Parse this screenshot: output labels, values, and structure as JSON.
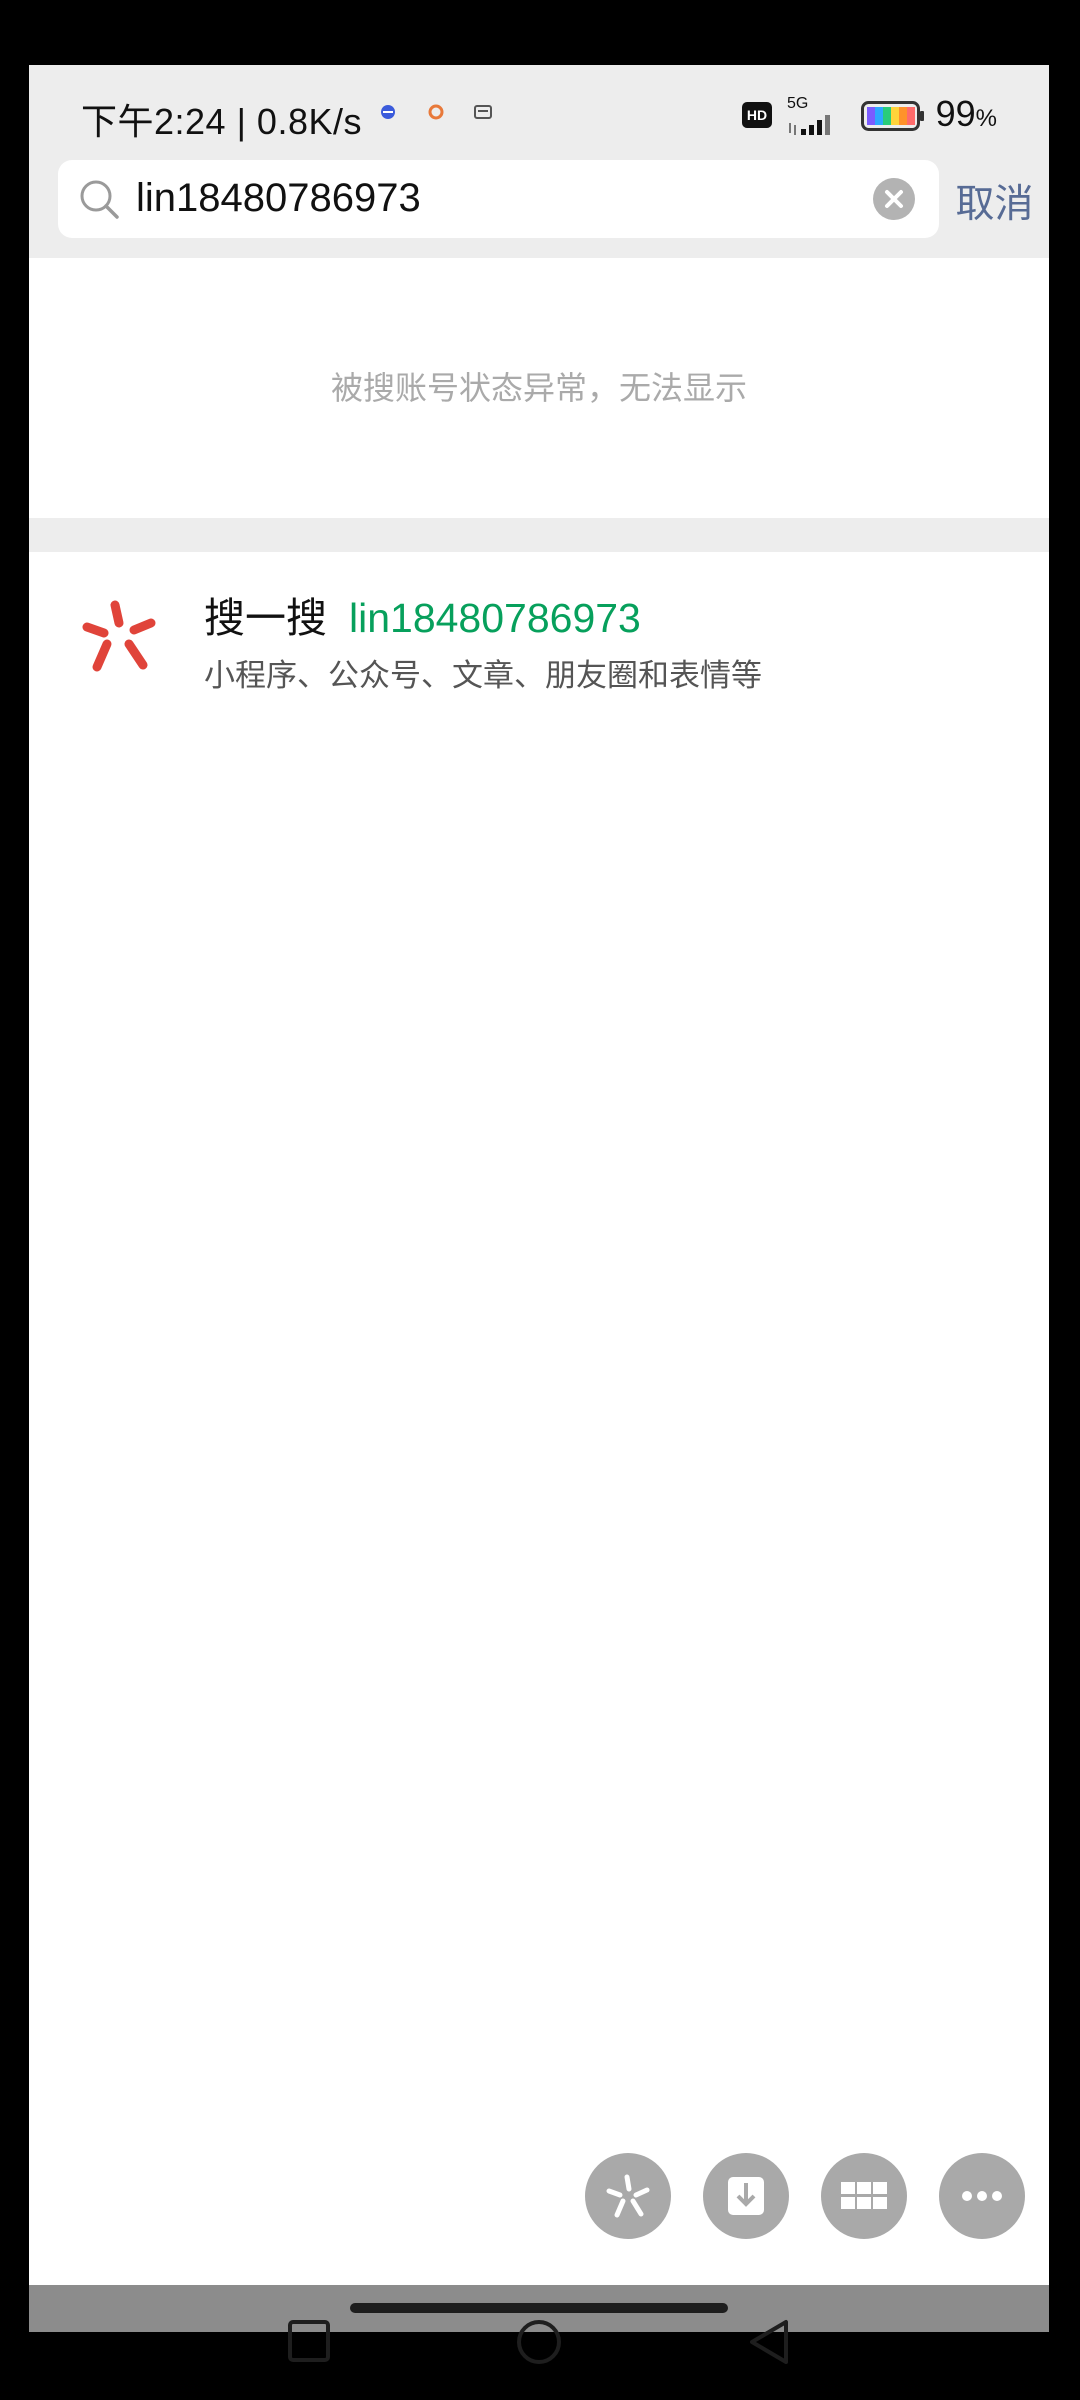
{
  "status_bar": {
    "time_and_speed": "下午2:24 | 0.8K/s",
    "network_hd": "HD",
    "network_type": "5G",
    "battery_percent": "99",
    "battery_unit": "%"
  },
  "search": {
    "query": "lin18480786973",
    "cancel_label": "取消",
    "icons": {
      "search": "search-icon",
      "clear": "clear-icon"
    }
  },
  "notice": {
    "message": "被搜账号状态异常，无法显示"
  },
  "result": {
    "title": "搜一搜",
    "keyword": "lin18480786973",
    "subtitle": "小程序、公众号、文章、朋友圈和表情等",
    "icon": "sousou-logo-icon"
  },
  "floating_buttons": [
    {
      "name": "sousou-float-icon"
    },
    {
      "name": "download-icon"
    },
    {
      "name": "grid-icon"
    },
    {
      "name": "more-icon"
    }
  ],
  "colors": {
    "keyword_green": "#07a05c",
    "cancel_blue": "#576b95",
    "logo_red": "#e0443a",
    "hint_gray": "#aaaaaa"
  }
}
